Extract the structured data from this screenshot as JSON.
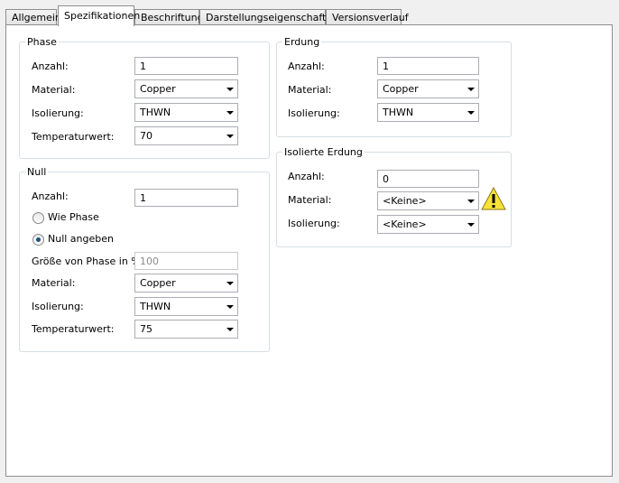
{
  "tabs": [
    {
      "label": "Allgemein"
    },
    {
      "label": "Spezifikationen"
    },
    {
      "label": "Beschriftung"
    },
    {
      "label": "Darstellungseigenschaften"
    },
    {
      "label": "Versionsverlauf"
    }
  ],
  "active_tab": "Spezifikationen",
  "phase": {
    "title": "Phase",
    "anzahl_label": "Anzahl:",
    "anzahl_value": "1",
    "material_label": "Material:",
    "material_value": "Copper",
    "isolierung_label": "Isolierung:",
    "isolierung_value": "THWN",
    "temperatur_label": "Temperaturwert:",
    "temperatur_value": "70"
  },
  "null": {
    "title": "Null",
    "anzahl_label": "Anzahl:",
    "anzahl_value": "1",
    "wie_phase_label": "Wie Phase",
    "wie_phase_checked": false,
    "null_angeben_label": "Null angeben",
    "null_angeben_checked": true,
    "groesse_label": "Größe von Phase in %:",
    "groesse_value": "100",
    "material_label": "Material:",
    "material_value": "Copper",
    "isolierung_label": "Isolierung:",
    "isolierung_value": "THWN",
    "temperatur_label": "Temperaturwert:",
    "temperatur_value": "75"
  },
  "erdung": {
    "title": "Erdung",
    "anzahl_label": "Anzahl:",
    "anzahl_value": "1",
    "material_label": "Material:",
    "material_value": "Copper",
    "isolierung_label": "Isolierung:",
    "isolierung_value": "THWN"
  },
  "isolierte_erdung": {
    "title": "Isolierte Erdung",
    "anzahl_label": "Anzahl:",
    "anzahl_value": "0",
    "material_label": "Material:",
    "material_value": "<Keine>",
    "isolierung_label": "Isolierung:",
    "isolierung_value": "<Keine>",
    "warning_icon": "warning-triangle-icon"
  },
  "colors": {
    "radio_dot": "#1c5180",
    "group_border": "#d5dfe5",
    "warning_fill": "#f8e23a"
  }
}
